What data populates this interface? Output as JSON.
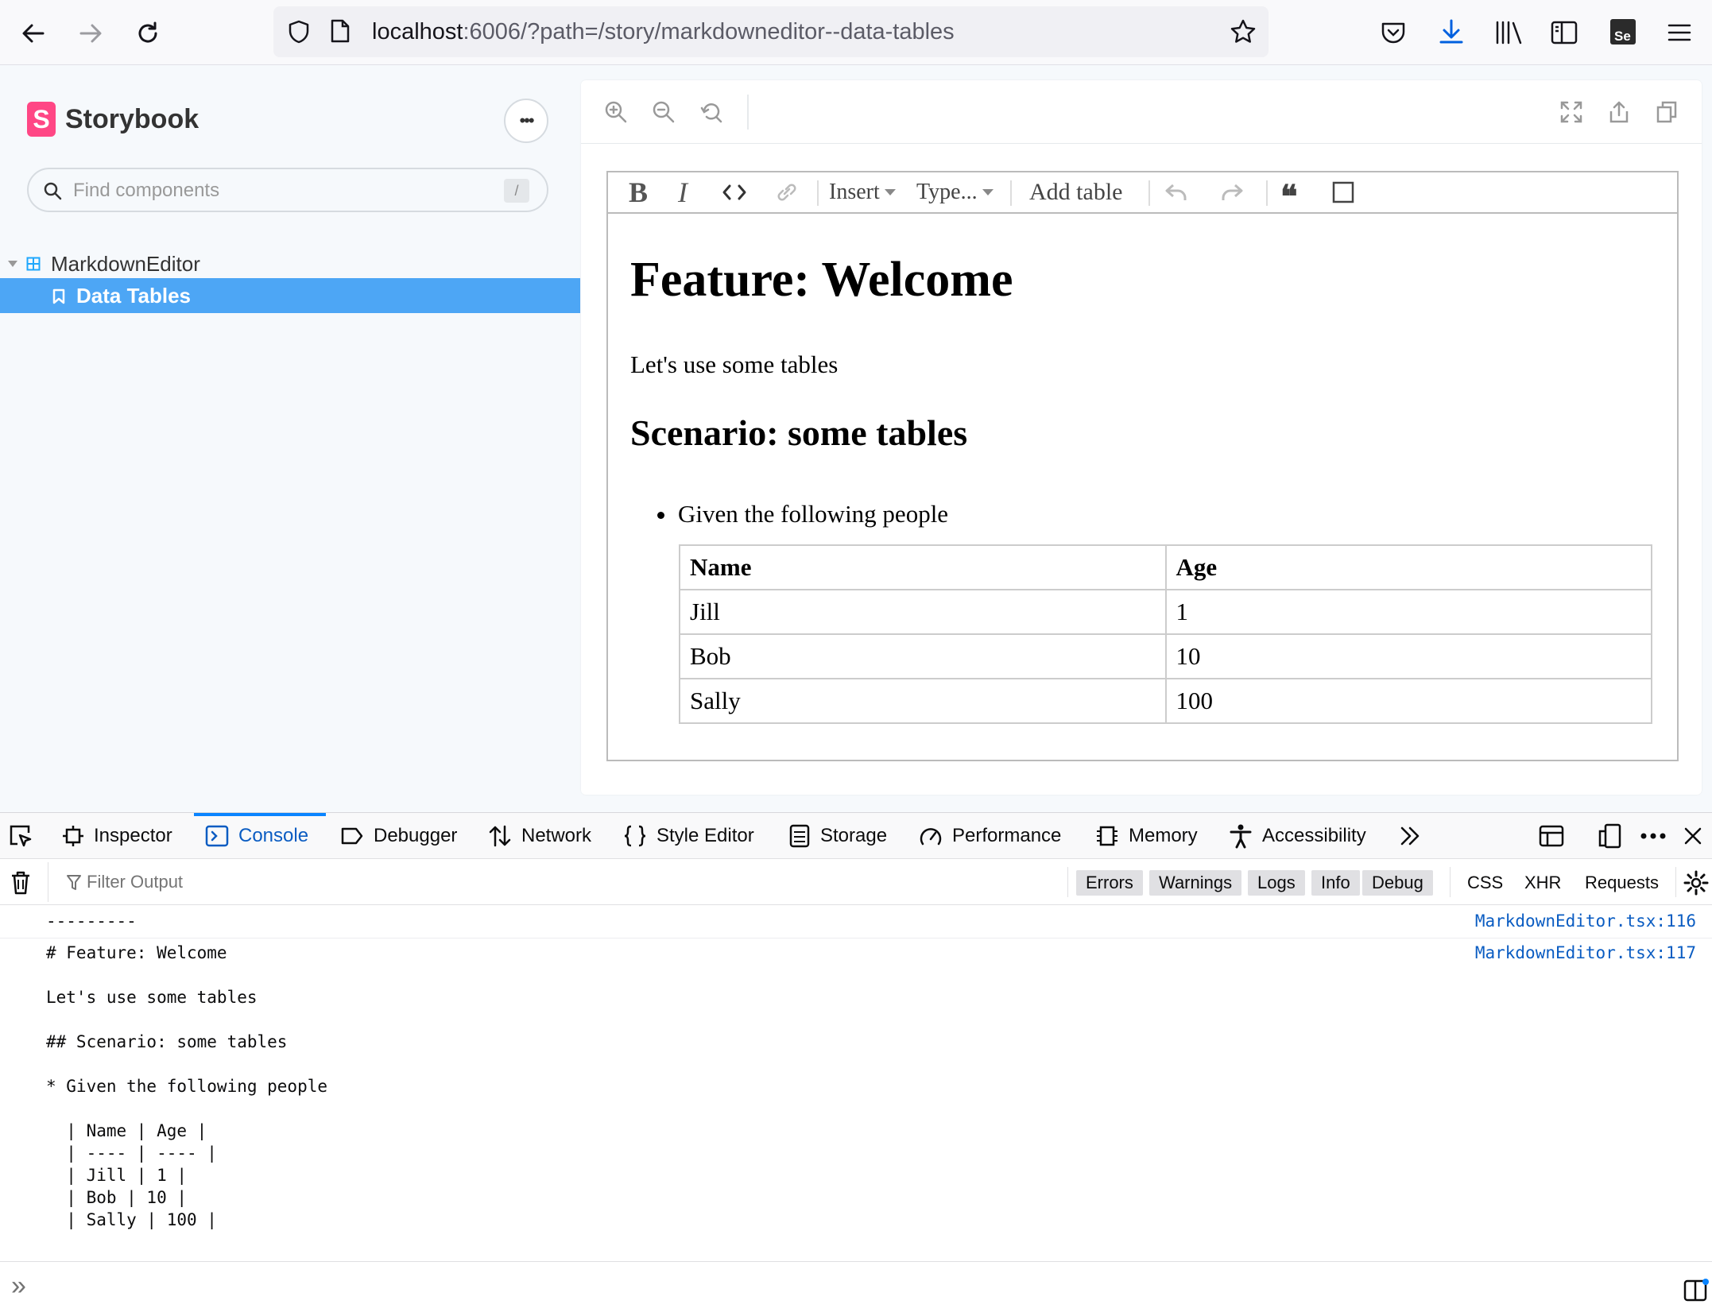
{
  "browser": {
    "url_host": "localhost",
    "url_rest": ":6006/?path=/story/markdowneditor--data-tables"
  },
  "storybook": {
    "logo_letter": "S",
    "brand": "Storybook",
    "more_label": "•••",
    "search_placeholder": "Find components",
    "search_shortcut": "/",
    "tree": {
      "component": "MarkdownEditor",
      "story": "Data Tables"
    }
  },
  "editor": {
    "toolbar": {
      "bold": "B",
      "italic": "I",
      "code": "<>",
      "insert": "Insert",
      "type": "Type...",
      "add_table": "Add table",
      "quote": "❝"
    },
    "content": {
      "h1": "Feature: Welcome",
      "paragraph": "Let's use some tables",
      "h2": "Scenario: some tables",
      "list_item": "Given the following people",
      "table": {
        "headers": [
          "Name",
          "Age"
        ],
        "rows": [
          [
            "Jill",
            "1"
          ],
          [
            "Bob",
            "10"
          ],
          [
            "Sally",
            "100"
          ]
        ]
      }
    }
  },
  "devtools": {
    "tabs": [
      "Inspector",
      "Console",
      "Debugger",
      "Network",
      "Style Editor",
      "Storage",
      "Performance",
      "Memory",
      "Accessibility"
    ],
    "active_tab": "Console",
    "filter_placeholder": "Filter Output",
    "levels": [
      "Errors",
      "Warnings",
      "Logs",
      "Info",
      "Debug"
    ],
    "extras": [
      "CSS",
      "XHR",
      "Requests"
    ],
    "messages": [
      {
        "text": "---------",
        "source": "MarkdownEditor.tsx:116"
      },
      {
        "text": "# Feature: Welcome\n\nLet's use some tables\n\n## Scenario: some tables\n\n* Given the following people\n\n  | Name | Age |\n  | ---- | ---- |\n  | Jill | 1 |\n  | Bob | 10 |\n  | Sally | 100 |",
        "source": "MarkdownEditor.tsx:117"
      }
    ],
    "prompt": "»"
  }
}
